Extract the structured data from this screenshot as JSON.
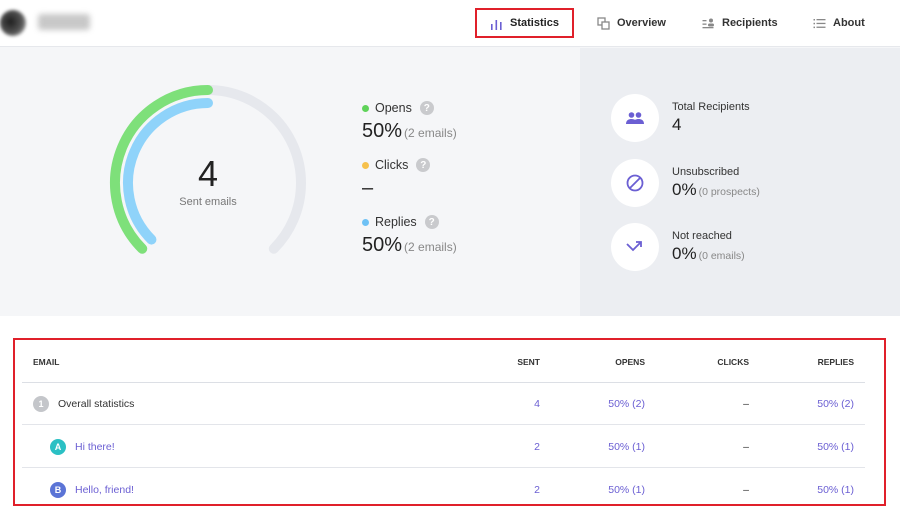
{
  "nav": {
    "statistics": "Statistics",
    "overview": "Overview",
    "recipients": "Recipients",
    "about": "About"
  },
  "gauge": {
    "sent_count": "4",
    "sent_label": "Sent emails",
    "opens_fraction": 0.5,
    "replies_fraction": 0.5
  },
  "metrics": {
    "opens": {
      "label": "Opens",
      "value": "50%",
      "sub": "(2 emails)",
      "color": "#5fd35a"
    },
    "clicks": {
      "label": "Clicks",
      "value": "–",
      "sub": "",
      "color": "#f6c14d"
    },
    "replies": {
      "label": "Replies",
      "value": "50%",
      "sub": "(2 emails)",
      "color": "#6ec1f5"
    },
    "help_glyph": "?"
  },
  "side": {
    "total": {
      "label": "Total Recipients",
      "value": "4",
      "sub": "",
      "icon": "people-icon"
    },
    "unsubscribed": {
      "label": "Unsubscribed",
      "value": "0%",
      "sub": "(0 prospects)",
      "icon": "blocked-icon"
    },
    "not_reached": {
      "label": "Not reached",
      "value": "0%",
      "sub": "(0 emails)",
      "icon": "bounce-arrow-icon"
    },
    "accent": "#6b5fd3"
  },
  "table": {
    "headers": {
      "email": "EMAIL",
      "sent": "SENT",
      "opens": "OPENS",
      "clicks": "CLICKS",
      "replies": "REPLIES"
    },
    "rows": [
      {
        "badge": "1",
        "email": "Overall statistics",
        "sent": "4",
        "opens": "50% (2)",
        "clicks": "–",
        "replies": "50% (2)"
      },
      {
        "badge": "A",
        "email": "Hi there!",
        "sent": "2",
        "opens": "50% (1)",
        "clicks": "–",
        "replies": "50% (1)"
      },
      {
        "badge": "B",
        "email": "Hello, friend!",
        "sent": "2",
        "opens": "50% (1)",
        "clicks": "–",
        "replies": "50% (1)"
      }
    ]
  }
}
